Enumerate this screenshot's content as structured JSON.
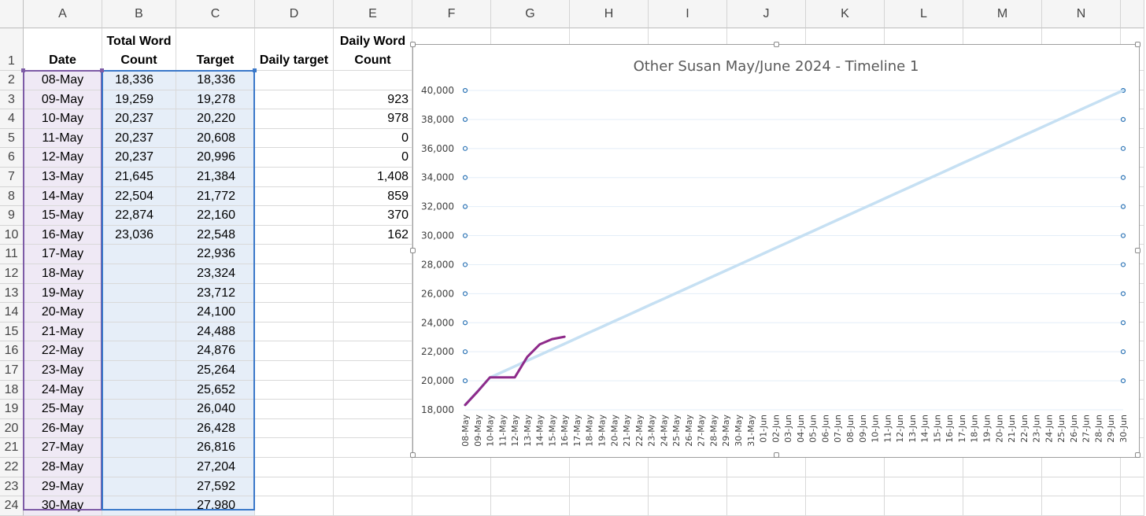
{
  "columns": [
    "A",
    "B",
    "C",
    "D",
    "E",
    "F",
    "G",
    "H",
    "I",
    "J",
    "K",
    "L",
    "M",
    "N"
  ],
  "headers": {
    "date": "Date",
    "total_word_count": "Total Word Count",
    "target": "Target",
    "daily_target": "Daily target",
    "daily_word_count": "Daily Word Count"
  },
  "rows": [
    {
      "row": "2",
      "date": "08-May",
      "total": "18,336",
      "target": "18,336",
      "daily": ""
    },
    {
      "row": "3",
      "date": "09-May",
      "total": "19,259",
      "target": "19,278",
      "daily": "923"
    },
    {
      "row": "4",
      "date": "10-May",
      "total": "20,237",
      "target": "20,220",
      "daily": "978"
    },
    {
      "row": "5",
      "date": "11-May",
      "total": "20,237",
      "target": "20,608",
      "daily": "0"
    },
    {
      "row": "6",
      "date": "12-May",
      "total": "20,237",
      "target": "20,996",
      "daily": "0"
    },
    {
      "row": "7",
      "date": "13-May",
      "total": "21,645",
      "target": "21,384",
      "daily": "1,408"
    },
    {
      "row": "8",
      "date": "14-May",
      "total": "22,504",
      "target": "21,772",
      "daily": "859"
    },
    {
      "row": "9",
      "date": "15-May",
      "total": "22,874",
      "target": "22,160",
      "daily": "370"
    },
    {
      "row": "10",
      "date": "16-May",
      "total": "23,036",
      "target": "22,548",
      "daily": "162"
    },
    {
      "row": "11",
      "date": "17-May",
      "total": "",
      "target": "22,936",
      "daily": ""
    },
    {
      "row": "12",
      "date": "18-May",
      "total": "",
      "target": "23,324",
      "daily": ""
    },
    {
      "row": "13",
      "date": "19-May",
      "total": "",
      "target": "23,712",
      "daily": ""
    },
    {
      "row": "14",
      "date": "20-May",
      "total": "",
      "target": "24,100",
      "daily": ""
    },
    {
      "row": "15",
      "date": "21-May",
      "total": "",
      "target": "24,488",
      "daily": ""
    },
    {
      "row": "16",
      "date": "22-May",
      "total": "",
      "target": "24,876",
      "daily": ""
    },
    {
      "row": "17",
      "date": "23-May",
      "total": "",
      "target": "25,264",
      "daily": ""
    },
    {
      "row": "18",
      "date": "24-May",
      "total": "",
      "target": "25,652",
      "daily": ""
    },
    {
      "row": "19",
      "date": "25-May",
      "total": "",
      "target": "26,040",
      "daily": ""
    },
    {
      "row": "20",
      "date": "26-May",
      "total": "",
      "target": "26,428",
      "daily": ""
    },
    {
      "row": "21",
      "date": "27-May",
      "total": "",
      "target": "26,816",
      "daily": ""
    },
    {
      "row": "22",
      "date": "28-May",
      "total": "",
      "target": "27,204",
      "daily": ""
    },
    {
      "row": "23",
      "date": "29-May",
      "total": "",
      "target": "27,592",
      "daily": ""
    },
    {
      "row": "24",
      "date": "30-May",
      "total": "",
      "target": "27,980",
      "daily": ""
    }
  ],
  "chart_data": {
    "type": "line",
    "title": "Other Susan May/June 2024 - Timeline 1",
    "categories": [
      "08-May",
      "09-May",
      "10-May",
      "11-May",
      "12-May",
      "13-May",
      "14-May",
      "15-May",
      "16-May",
      "17-May",
      "18-May",
      "19-May",
      "20-May",
      "21-May",
      "22-May",
      "23-May",
      "24-May",
      "25-May",
      "26-May",
      "27-May",
      "28-May",
      "29-May",
      "30-May",
      "31-May",
      "01-Jun",
      "02-Jun",
      "03-Jun",
      "04-Jun",
      "05-Jun",
      "06-Jun",
      "07-Jun",
      "08-Jun",
      "09-Jun",
      "10-Jun",
      "11-Jun",
      "12-Jun",
      "13-Jun",
      "14-Jun",
      "15-Jun",
      "16-Jun",
      "17-Jun",
      "18-Jun",
      "19-Jun",
      "20-Jun",
      "21-Jun",
      "22-Jun",
      "23-Jun",
      "24-Jun",
      "25-Jun",
      "26-Jun",
      "27-Jun",
      "28-Jun",
      "29-Jun",
      "30-Jun"
    ],
    "ylim": [
      18000,
      40000
    ],
    "yticks": [
      18000,
      20000,
      22000,
      24000,
      26000,
      28000,
      30000,
      32000,
      34000,
      36000,
      38000,
      40000
    ],
    "ytick_labels": [
      "18,000",
      "20,000",
      "22,000",
      "24,000",
      "26,000",
      "28,000",
      "30,000",
      "32,000",
      "34,000",
      "36,000",
      "38,000",
      "40,000"
    ],
    "grid": true,
    "series": [
      {
        "values": [
          18336,
          19278,
          20220,
          20608,
          20996,
          21384,
          21772,
          22160,
          22548,
          22936,
          23324,
          23712,
          24100,
          24488,
          24876,
          25264,
          25652,
          26040,
          26428,
          26816,
          27204,
          27592,
          27980,
          28368,
          28756,
          29144,
          29532,
          29920,
          30308,
          30696,
          31084,
          31472,
          31860,
          32248,
          32636,
          33024,
          33412,
          33800,
          34188,
          34576,
          34964,
          35352,
          35740,
          36128,
          36516,
          36904,
          37292,
          37680,
          38068,
          38456,
          38844,
          39232,
          39620,
          40000
        ],
        "color": "#c6e0f3"
      },
      {
        "values": [
          18336,
          19259,
          20237,
          20237,
          20237,
          21645,
          22504,
          22874,
          23036
        ],
        "color": "#8e2a8a"
      }
    ],
    "marker_color": "#2e75b6"
  }
}
